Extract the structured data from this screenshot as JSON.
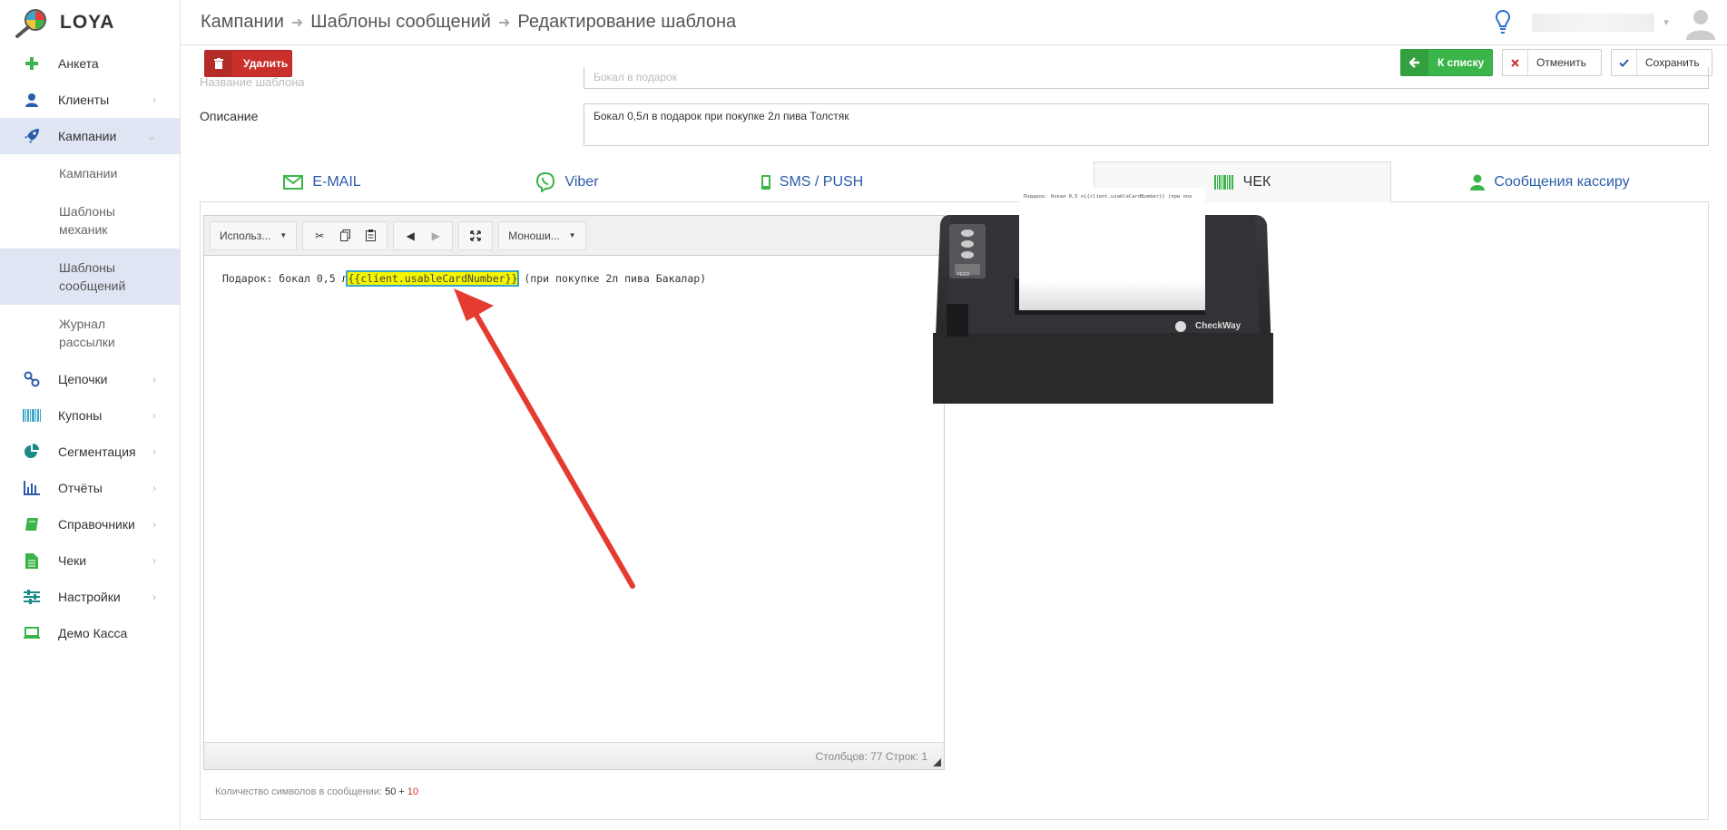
{
  "app": {
    "name": "LOYA"
  },
  "sidebar": {
    "items": [
      {
        "label": "Анкета",
        "icon": "plus-icon"
      },
      {
        "label": "Клиенты",
        "icon": "user-icon"
      },
      {
        "label": "Кампании",
        "icon": "rocket-icon"
      },
      {
        "label": "Цепочки",
        "icon": "link-icon"
      },
      {
        "label": "Купоны",
        "icon": "barcode-icon"
      },
      {
        "label": "Сегментация",
        "icon": "pie-chart-icon"
      },
      {
        "label": "Отчёты",
        "icon": "bar-chart-icon"
      },
      {
        "label": "Справочники",
        "icon": "book-icon"
      },
      {
        "label": "Чеки",
        "icon": "document-icon"
      },
      {
        "label": "Настройки",
        "icon": "sliders-icon"
      },
      {
        "label": "Демо Касса",
        "icon": "laptop-icon"
      }
    ],
    "sub_items": [
      {
        "label": "Кампании"
      },
      {
        "label": "Шаблоны механик"
      },
      {
        "label": "Шаблоны сообщений"
      },
      {
        "label": "Журнал рассылки"
      }
    ]
  },
  "breadcrumbs": [
    "Кампании",
    "Шаблоны сообщений",
    "Редактирование шаблона"
  ],
  "toolbar": {
    "delete_label": "Удалить",
    "list_label": "К списку",
    "cancel_label": "Отменить",
    "save_label": "Сохранить"
  },
  "form": {
    "name_label": "Название шаблона",
    "name_value": "Бокал в подарок",
    "description_label": "Описание",
    "description_value": "Бокал 0,5л в подарок при покупке 2л пива Толстяк"
  },
  "tabs": [
    {
      "label": "E-MAIL",
      "icon": "envelope-icon"
    },
    {
      "label": "Viber",
      "icon": "viber-icon"
    },
    {
      "label": "SMS / PUSH",
      "icon": "mobile-icon"
    },
    {
      "label": "ЧЕК",
      "icon": "barcode-icon"
    },
    {
      "label": "Сообщения кассиру",
      "icon": "user-icon"
    }
  ],
  "editor": {
    "format_select": "Использ...",
    "font_select": "Моноши...",
    "text_before": "Подарок: бокал 0,5 л",
    "text_placeholder": "{{client.usableCardNumber}}",
    "text_after": " (при покупке 2л пива Бакалар)",
    "status": "Столбцов: 77 Строк: 1"
  },
  "char_count": {
    "label": "Количество символов в сообщении:",
    "base": "50",
    "plus": "+",
    "extra": "10"
  },
  "preview": {
    "receipt_text": "Подарок: бокал 0,5 л{{client.usableCardNumber}} (при пок",
    "brand": "CheckWay",
    "feed_label": "FEED"
  },
  "colors": {
    "accent_green": "#3bb54a",
    "danger_red": "#c9302c",
    "link_blue": "#2a5caa",
    "active_nav_bg": "#dfe5f2",
    "annotation_arrow": "#e53a2f"
  }
}
